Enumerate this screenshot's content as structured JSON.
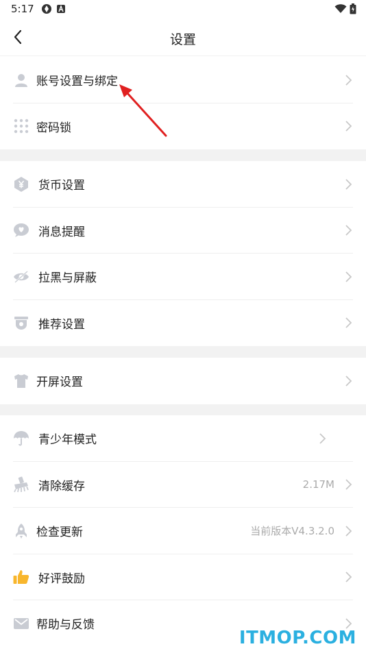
{
  "status_bar": {
    "time": "5:17"
  },
  "header": {
    "title": "设置"
  },
  "groups": [
    {
      "items": [
        {
          "label": "账号设置与绑定",
          "icon": "user-icon"
        },
        {
          "label": "密码锁",
          "icon": "dot-grid-icon"
        }
      ]
    },
    {
      "items": [
        {
          "label": "货币设置",
          "icon": "yen-coin-icon"
        },
        {
          "label": "消息提醒",
          "icon": "chat-heart-icon"
        },
        {
          "label": "拉黑与屏蔽",
          "icon": "eye-off-icon"
        },
        {
          "label": "推荐设置",
          "icon": "recommend-icon"
        }
      ]
    },
    {
      "items": [
        {
          "label": "开屏设置",
          "icon": "shirt-icon"
        }
      ]
    },
    {
      "items": [
        {
          "label": "青少年模式",
          "icon": "umbrella-icon"
        },
        {
          "label": "清除缓存",
          "icon": "broom-icon",
          "value": "2.17M"
        },
        {
          "label": "检查更新",
          "icon": "rocket-icon",
          "value": "当前版本V4.3.2.0"
        },
        {
          "label": "好评鼓励",
          "icon": "thumbs-up-icon"
        },
        {
          "label": "帮助与反馈",
          "icon": "mail-icon"
        }
      ]
    }
  ],
  "watermark": "ITMOP.COM",
  "colors": {
    "icon_gray": "#c9ccd3",
    "thumb_yellow": "#f8b62d",
    "arrow_red": "#e02020",
    "separator": "#f2f2f2",
    "watermark_blue": "#2bb0e0"
  }
}
